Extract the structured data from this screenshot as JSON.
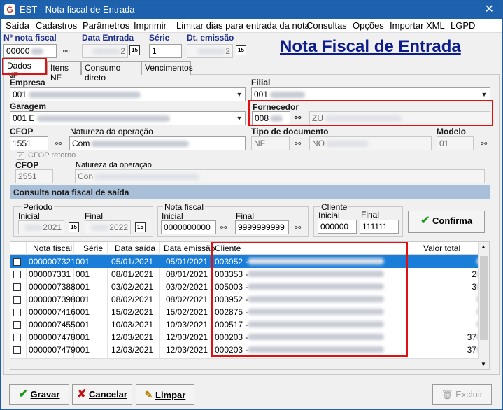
{
  "window": {
    "title": "EST - Nota fiscal de Entrada",
    "app_icon": "G",
    "close_glyph": "✕"
  },
  "menu": [
    "Saída",
    "Cadastros",
    "Parâmetros",
    "Imprimir",
    "Limitar dias para entrada da nota",
    "Consultas",
    "Opções",
    "Importar XML",
    "LGPD"
  ],
  "header": {
    "nf_label": "Nº nota fiscal",
    "nf_value": "00000",
    "data_entrada_label": "Data Entrada",
    "data_entrada_suffix": "2",
    "serie_label": "Série",
    "serie_value": "1",
    "dt_emissao_label": "Dt. emissão",
    "dt_emissao_suffix": "2",
    "big_title": "Nota Fiscal de Entrada",
    "calendar_glyph": "15"
  },
  "tabs": [
    "Dados NF",
    "Itens NF",
    "Consumo direto",
    "Vencimentos"
  ],
  "form": {
    "empresa_label": "Empresa",
    "empresa_value": "001",
    "filial_label": "Filial",
    "filial_value": "001",
    "garagem_label": "Garagem",
    "garagem_value": "001 E",
    "fornecedor_label": "Fornecedor",
    "fornecedor_code": "008",
    "fornecedor_name": "ZU",
    "cfop_label": "CFOP",
    "cfop_value": "1551",
    "natureza_label": "Natureza da operação",
    "natureza_value": "Com",
    "tipo_doc_label": "Tipo de documento",
    "tipo_doc_value": "NF",
    "tipo_doc_desc": "NO",
    "modelo_label": "Modelo",
    "modelo_value": "01",
    "cfop_retorno_label": "CFOP retorno",
    "cfop2_label": "CFOP",
    "cfop2_value": "2551",
    "natureza2_label": "Natureza da operação",
    "natureza2_value": "Con"
  },
  "consulta": {
    "section_title": "Consulta nota fiscal de saída",
    "periodo_label": "Período",
    "inicial_label": "Inicial",
    "final_label": "Final",
    "periodo_inicial_year": "2021",
    "periodo_final_year": "2022",
    "nf_group_label": "Nota fiscal",
    "nf_inicial": "0000000000",
    "nf_final": "9999999999",
    "cliente_group_label": "Cliente",
    "cliente_inicial": "000000",
    "cliente_final": "111111",
    "confirma_label": "Confirma"
  },
  "table": {
    "columns": [
      "Nota fiscal",
      "Série",
      "Data saída",
      "Data emissão",
      "Cliente",
      "Valor total"
    ],
    "rows": [
      {
        "nf": "0000007321",
        "serie": "001",
        "saida": "05/01/2021",
        "emissao": "05/01/2021",
        "cliente": "003952 -",
        "valor": "",
        "selected": true
      },
      {
        "nf": "000007331",
        "serie": "001",
        "saida": "08/01/2021",
        "emissao": "08/01/2021",
        "cliente": "003353 -",
        "valor": "2",
        "selected": false
      },
      {
        "nf": "0000007388",
        "serie": "001",
        "saida": "03/02/2021",
        "emissao": "03/02/2021",
        "cliente": "005003 -",
        "valor": "3",
        "selected": false
      },
      {
        "nf": "0000007398",
        "serie": "001",
        "saida": "08/02/2021",
        "emissao": "08/02/2021",
        "cliente": "003952 -",
        "valor": "",
        "selected": false
      },
      {
        "nf": "0000007416",
        "serie": "001",
        "saida": "15/02/2021",
        "emissao": "15/02/2021",
        "cliente": "002875 -",
        "valor": "",
        "selected": false
      },
      {
        "nf": "0000007455",
        "serie": "001",
        "saida": "10/03/2021",
        "emissao": "10/03/2021",
        "cliente": "000517 -",
        "valor": "",
        "selected": false
      },
      {
        "nf": "0000007478",
        "serie": "001",
        "saida": "12/03/2021",
        "emissao": "12/03/2021",
        "cliente": "000203 -",
        "valor": "37",
        "selected": false
      },
      {
        "nf": "0000007479",
        "serie": "001",
        "saida": "12/03/2021",
        "emissao": "12/03/2021",
        "cliente": "000203 -",
        "valor": "37",
        "selected": false
      }
    ]
  },
  "buttons": {
    "gravar": "Gravar",
    "cancelar": "Cancelar",
    "limpar": "Limpar",
    "excluir": "Excluir"
  }
}
